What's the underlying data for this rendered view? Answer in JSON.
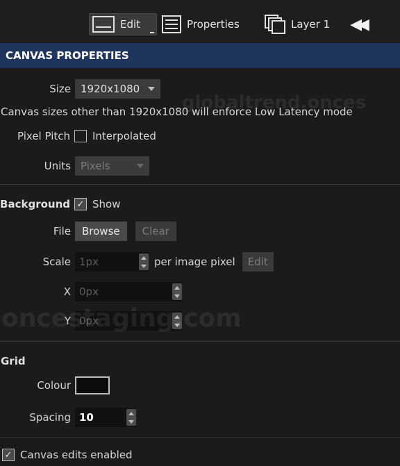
{
  "toolbar": {
    "edit_label": "Edit",
    "properties_label": "Properties",
    "layer_label": "Layer 1",
    "collapse_glyph": "◀◀"
  },
  "header": {
    "title": "CANVAS PROPERTIES"
  },
  "canvas": {
    "size_label": "Size",
    "size_value": "1920x1080",
    "note": "Canvas sizes other than 1920x1080 will enforce Low Latency mode",
    "pixel_pitch_label": "Pixel Pitch",
    "interpolated_label": "Interpolated",
    "interpolated_checked": false,
    "units_label": "Units",
    "units_value": "Pixels"
  },
  "background": {
    "title": "Background",
    "show_label": "Show",
    "show_checked": true,
    "file_label": "File",
    "browse_label": "Browse",
    "clear_label": "Clear",
    "scale_label": "Scale",
    "scale_value": "1px",
    "scale_suffix": "per image pixel",
    "edit_label": "Edit",
    "x_label": "X",
    "x_value": "0px",
    "y_label": "Y",
    "y_value": "0px"
  },
  "grid": {
    "title": "Grid",
    "colour_label": "Colour",
    "colour_value": "#0d0d0d",
    "spacing_label": "Spacing",
    "spacing_value": "10"
  },
  "footer": {
    "edits_label": "Canvas edits enabled",
    "edits_checked": true
  },
  "watermarks": [
    "globaltrend.onces",
    "oncestaging.com"
  ],
  "colors": {
    "header_bg": "#20355e",
    "panel_bg": "#1b1b1b"
  }
}
